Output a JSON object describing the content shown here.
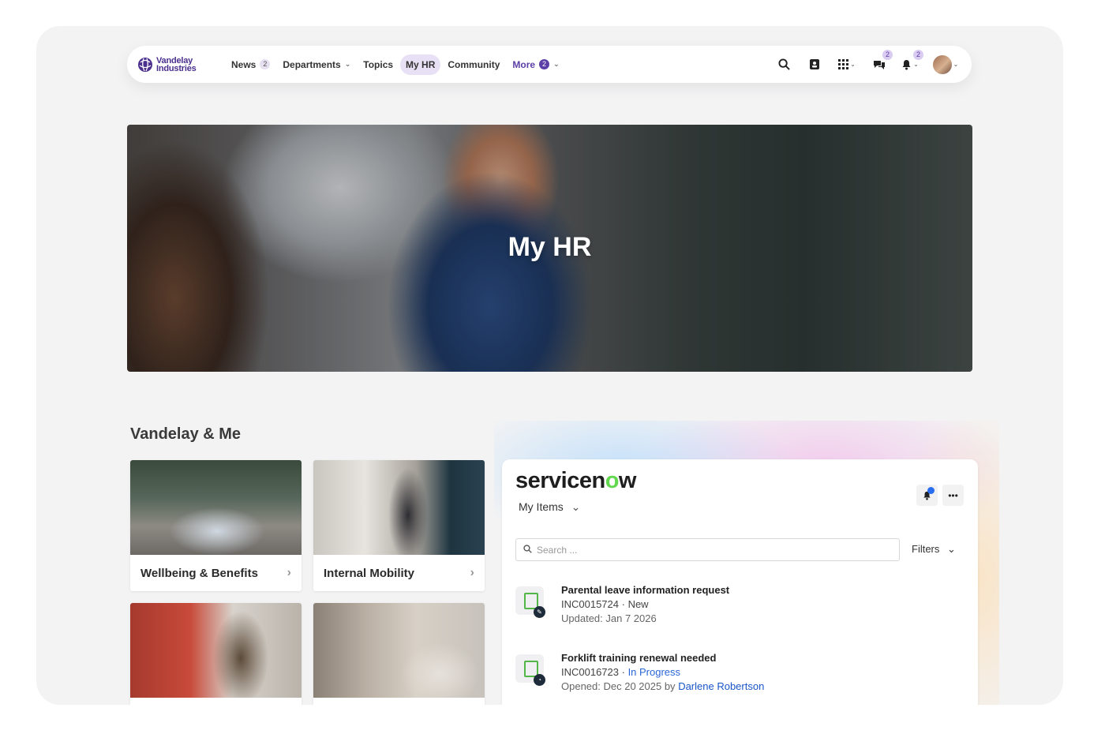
{
  "nav": {
    "logo_line1": "Vandelay",
    "logo_line2": "Industries",
    "items": [
      {
        "label": "News",
        "badge": "2"
      },
      {
        "label": "Departments",
        "chevron": "⌄"
      },
      {
        "label": "Topics"
      },
      {
        "label": "My HR",
        "active": true
      },
      {
        "label": "Community"
      },
      {
        "label": "More",
        "badge": "2",
        "chevron": "⌄"
      }
    ],
    "chat_badge": "2",
    "bell_badge": "2"
  },
  "hero": {
    "title": "My HR"
  },
  "section": {
    "title": "Vandelay & Me"
  },
  "cards": [
    {
      "label": "Wellbeing & Benefits"
    },
    {
      "label": "Internal Mobility"
    },
    {
      "label": ""
    },
    {
      "label": ""
    }
  ],
  "servicenow": {
    "logo_pre": "servicen",
    "logo_o": "o",
    "logo_post": "w",
    "dropdown": "My Items",
    "search_placeholder": "Search ...",
    "filters": "Filters",
    "items": [
      {
        "title": "Parental leave information request",
        "number": "INC0015724",
        "status": "New",
        "meta": "Updated: Jan 7 2026"
      },
      {
        "title": "Forklift training renewal needed",
        "number": "INC0016723",
        "status": "In Progress",
        "meta_prefix": "Opened: Dec 20 2025 by",
        "person": "Darlene Robertson"
      }
    ]
  },
  "colors": {
    "brand": "#4a2f8f",
    "accent": "#5b3ea6",
    "link": "#2a66d8",
    "sn_green": "#62d84e"
  }
}
